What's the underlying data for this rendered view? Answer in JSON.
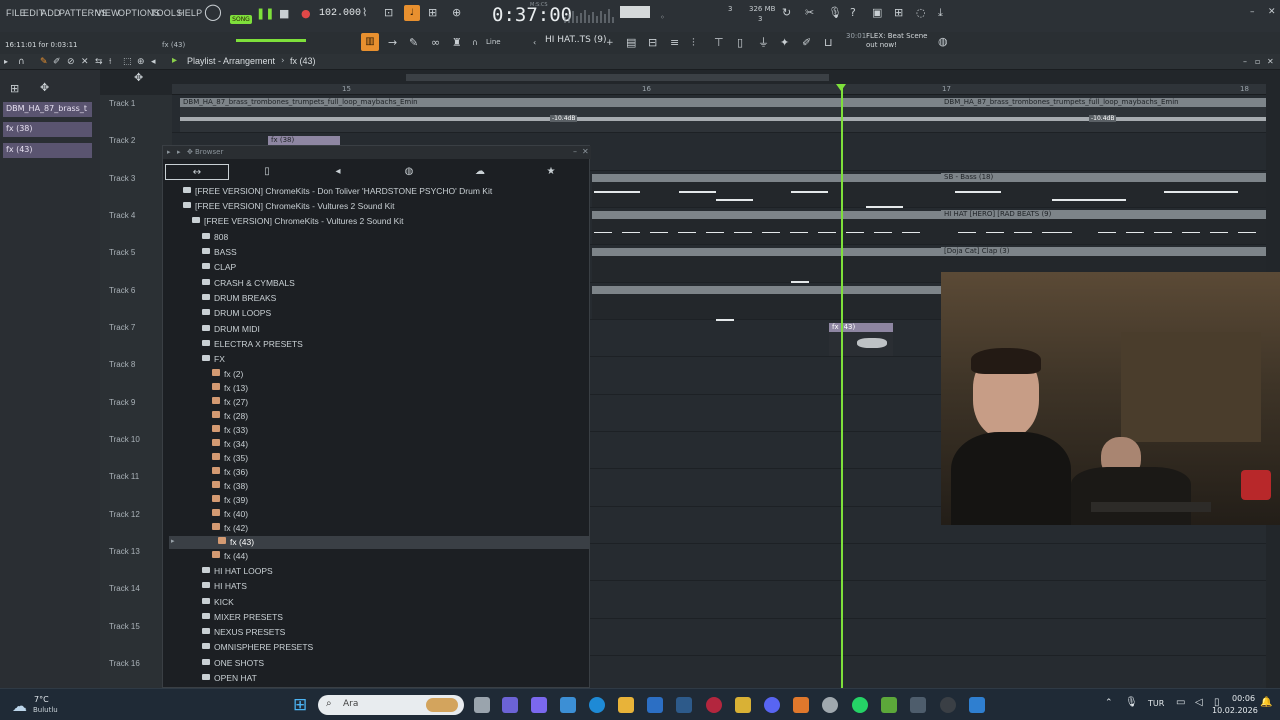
{
  "menu": {
    "items": [
      "FILE",
      "EDIT",
      "ADD",
      "PATTERNS",
      "VIEW",
      "OPTIONS",
      "TOOLS",
      "HELP"
    ]
  },
  "transport": {
    "song_label": "SONG",
    "bpm": "102.000",
    "time": "0:37:00",
    "time_unit": "M:S:CS",
    "memory": "326 MB",
    "cpu": "3",
    "voices": "3",
    "pattern_left": "fx (43)"
  },
  "status": {
    "timestamp": "16:11:01 for 0:03:11",
    "snap_label": "Line",
    "pattern_selector": "HI HAT..TS (9)",
    "news_time": "30:01",
    "news_text": "FLEX: Beat Scene out now!"
  },
  "playlist": {
    "title": "Playlist - Arrangement",
    "breadcrumb": "fx (43)"
  },
  "left_panel": {
    "items": [
      "DBM_HA_87_brass_t",
      "fx (38)",
      "fx (43)"
    ]
  },
  "ruler": {
    "marks": [
      "15",
      "16",
      "17",
      "18"
    ]
  },
  "tracks": [
    "Track 1",
    "Track 2",
    "Track 3",
    "Track 4",
    "Track 5",
    "Track 6",
    "Track 7",
    "Track 8",
    "Track 9",
    "Track 10",
    "Track 11",
    "Track 12",
    "Track 13",
    "Track 14",
    "Track 15",
    "Track 16"
  ],
  "clips": {
    "track1_a": "DBM_HA_87_brass_trombones_trumpets_full_loop_maybachs_Emin",
    "track1_b": "DBM_HA_87_brass_trombones_trumpets_full_loop_maybachs_Emin",
    "track1_gain_a": "-10.4dB",
    "track1_gain_b": "-10.4dB",
    "track2": "fx (38)",
    "track3": "SB - Bass (18)",
    "track4": "HI HAT [HERO] [RAD BEATS (9)",
    "track5": "[Doja Cat] Clap (3)",
    "track7": "fx (43)"
  },
  "browser": {
    "title": "Browser",
    "items": [
      {
        "label": "[FREE VERSION] ChromeKits  - Don Toliver 'HARDSTONE PSYCHO' Drum Kit",
        "kind": "folder"
      },
      {
        "label": "[FREE VERSION] ChromeKits - Vultures 2 Sound Kit",
        "kind": "folder"
      },
      {
        "label": "[FREE VERSION] ChromeKits - Vultures 2 Sound Kit",
        "kind": "folder"
      },
      {
        "label": "808",
        "kind": "folder"
      },
      {
        "label": "BASS",
        "kind": "folder"
      },
      {
        "label": "CLAP",
        "kind": "folder"
      },
      {
        "label": "CRASH & CYMBALS",
        "kind": "folder"
      },
      {
        "label": "DRUM BREAKS",
        "kind": "folder"
      },
      {
        "label": "DRUM LOOPS",
        "kind": "folder"
      },
      {
        "label": "DRUM MIDI",
        "kind": "folder"
      },
      {
        "label": "ELECTRA X PRESETS",
        "kind": "folder"
      },
      {
        "label": "FX",
        "kind": "folder"
      },
      {
        "label": "fx (2)",
        "kind": "file"
      },
      {
        "label": "fx (13)",
        "kind": "file"
      },
      {
        "label": "fx (27)",
        "kind": "file"
      },
      {
        "label": "fx (28)",
        "kind": "file"
      },
      {
        "label": "fx (33)",
        "kind": "file"
      },
      {
        "label": "fx (34)",
        "kind": "file"
      },
      {
        "label": "fx (35)",
        "kind": "file"
      },
      {
        "label": "fx (36)",
        "kind": "file"
      },
      {
        "label": "fx (38)",
        "kind": "file"
      },
      {
        "label": "fx (39)",
        "kind": "file"
      },
      {
        "label": "fx (40)",
        "kind": "file"
      },
      {
        "label": "fx (42)",
        "kind": "file"
      },
      {
        "label": "fx (43)",
        "kind": "file"
      },
      {
        "label": "fx (44)",
        "kind": "file"
      },
      {
        "label": "HI HAT LOOPS",
        "kind": "folder"
      },
      {
        "label": "HI HATS",
        "kind": "folder"
      },
      {
        "label": "KICK",
        "kind": "folder"
      },
      {
        "label": "MIXER PRESETS",
        "kind": "folder"
      },
      {
        "label": "NEXUS PRESETS",
        "kind": "folder"
      },
      {
        "label": "OMNISPHERE PRESETS",
        "kind": "folder"
      },
      {
        "label": "ONE SHOTS",
        "kind": "folder"
      },
      {
        "label": "OPEN HAT",
        "kind": "folder"
      }
    ],
    "selected_index": 24
  },
  "taskbar": {
    "temp": "7°C",
    "weather": "Bulutlu",
    "search_placeholder": "Ara",
    "lang": "TUR",
    "time": "00:06",
    "date": "10.02.2026"
  },
  "colors": {
    "accent": "#e8902f",
    "playhead": "#7ee03b",
    "clip": "#7d8489"
  }
}
